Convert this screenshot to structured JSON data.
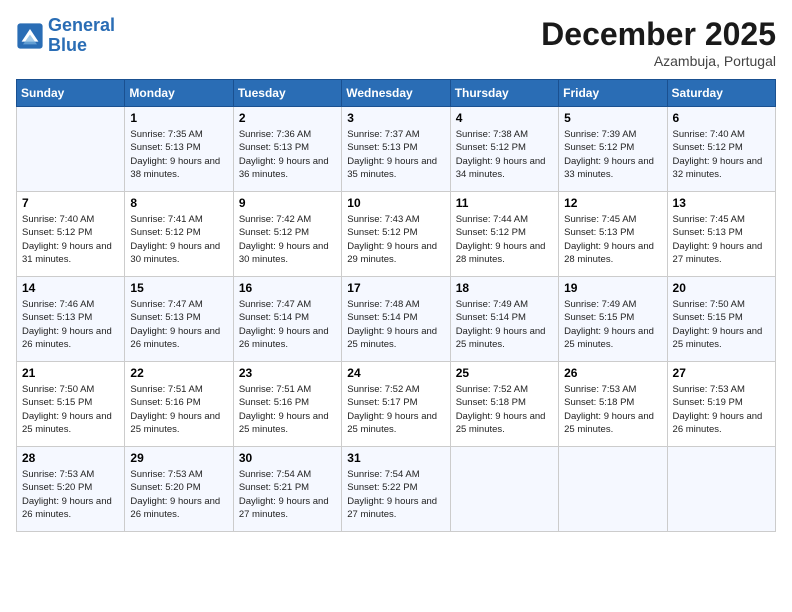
{
  "header": {
    "logo_line1": "General",
    "logo_line2": "Blue",
    "month": "December 2025",
    "location": "Azambuja, Portugal"
  },
  "weekdays": [
    "Sunday",
    "Monday",
    "Tuesday",
    "Wednesday",
    "Thursday",
    "Friday",
    "Saturday"
  ],
  "weeks": [
    [
      {
        "day": "",
        "empty": true
      },
      {
        "day": "1",
        "sunrise": "7:35 AM",
        "sunset": "5:13 PM",
        "daylight": "9 hours and 38 minutes."
      },
      {
        "day": "2",
        "sunrise": "7:36 AM",
        "sunset": "5:13 PM",
        "daylight": "9 hours and 36 minutes."
      },
      {
        "day": "3",
        "sunrise": "7:37 AM",
        "sunset": "5:13 PM",
        "daylight": "9 hours and 35 minutes."
      },
      {
        "day": "4",
        "sunrise": "7:38 AM",
        "sunset": "5:12 PM",
        "daylight": "9 hours and 34 minutes."
      },
      {
        "day": "5",
        "sunrise": "7:39 AM",
        "sunset": "5:12 PM",
        "daylight": "9 hours and 33 minutes."
      },
      {
        "day": "6",
        "sunrise": "7:40 AM",
        "sunset": "5:12 PM",
        "daylight": "9 hours and 32 minutes."
      }
    ],
    [
      {
        "day": "7",
        "sunrise": "7:40 AM",
        "sunset": "5:12 PM",
        "daylight": "9 hours and 31 minutes."
      },
      {
        "day": "8",
        "sunrise": "7:41 AM",
        "sunset": "5:12 PM",
        "daylight": "9 hours and 30 minutes."
      },
      {
        "day": "9",
        "sunrise": "7:42 AM",
        "sunset": "5:12 PM",
        "daylight": "9 hours and 30 minutes."
      },
      {
        "day": "10",
        "sunrise": "7:43 AM",
        "sunset": "5:12 PM",
        "daylight": "9 hours and 29 minutes."
      },
      {
        "day": "11",
        "sunrise": "7:44 AM",
        "sunset": "5:12 PM",
        "daylight": "9 hours and 28 minutes."
      },
      {
        "day": "12",
        "sunrise": "7:45 AM",
        "sunset": "5:13 PM",
        "daylight": "9 hours and 28 minutes."
      },
      {
        "day": "13",
        "sunrise": "7:45 AM",
        "sunset": "5:13 PM",
        "daylight": "9 hours and 27 minutes."
      }
    ],
    [
      {
        "day": "14",
        "sunrise": "7:46 AM",
        "sunset": "5:13 PM",
        "daylight": "9 hours and 26 minutes."
      },
      {
        "day": "15",
        "sunrise": "7:47 AM",
        "sunset": "5:13 PM",
        "daylight": "9 hours and 26 minutes."
      },
      {
        "day": "16",
        "sunrise": "7:47 AM",
        "sunset": "5:14 PM",
        "daylight": "9 hours and 26 minutes."
      },
      {
        "day": "17",
        "sunrise": "7:48 AM",
        "sunset": "5:14 PM",
        "daylight": "9 hours and 25 minutes."
      },
      {
        "day": "18",
        "sunrise": "7:49 AM",
        "sunset": "5:14 PM",
        "daylight": "9 hours and 25 minutes."
      },
      {
        "day": "19",
        "sunrise": "7:49 AM",
        "sunset": "5:15 PM",
        "daylight": "9 hours and 25 minutes."
      },
      {
        "day": "20",
        "sunrise": "7:50 AM",
        "sunset": "5:15 PM",
        "daylight": "9 hours and 25 minutes."
      }
    ],
    [
      {
        "day": "21",
        "sunrise": "7:50 AM",
        "sunset": "5:15 PM",
        "daylight": "9 hours and 25 minutes."
      },
      {
        "day": "22",
        "sunrise": "7:51 AM",
        "sunset": "5:16 PM",
        "daylight": "9 hours and 25 minutes."
      },
      {
        "day": "23",
        "sunrise": "7:51 AM",
        "sunset": "5:16 PM",
        "daylight": "9 hours and 25 minutes."
      },
      {
        "day": "24",
        "sunrise": "7:52 AM",
        "sunset": "5:17 PM",
        "daylight": "9 hours and 25 minutes."
      },
      {
        "day": "25",
        "sunrise": "7:52 AM",
        "sunset": "5:18 PM",
        "daylight": "9 hours and 25 minutes."
      },
      {
        "day": "26",
        "sunrise": "7:53 AM",
        "sunset": "5:18 PM",
        "daylight": "9 hours and 25 minutes."
      },
      {
        "day": "27",
        "sunrise": "7:53 AM",
        "sunset": "5:19 PM",
        "daylight": "9 hours and 26 minutes."
      }
    ],
    [
      {
        "day": "28",
        "sunrise": "7:53 AM",
        "sunset": "5:20 PM",
        "daylight": "9 hours and 26 minutes."
      },
      {
        "day": "29",
        "sunrise": "7:53 AM",
        "sunset": "5:20 PM",
        "daylight": "9 hours and 26 minutes."
      },
      {
        "day": "30",
        "sunrise": "7:54 AM",
        "sunset": "5:21 PM",
        "daylight": "9 hours and 27 minutes."
      },
      {
        "day": "31",
        "sunrise": "7:54 AM",
        "sunset": "5:22 PM",
        "daylight": "9 hours and 27 minutes."
      },
      {
        "day": "",
        "empty": true
      },
      {
        "day": "",
        "empty": true
      },
      {
        "day": "",
        "empty": true
      }
    ]
  ]
}
